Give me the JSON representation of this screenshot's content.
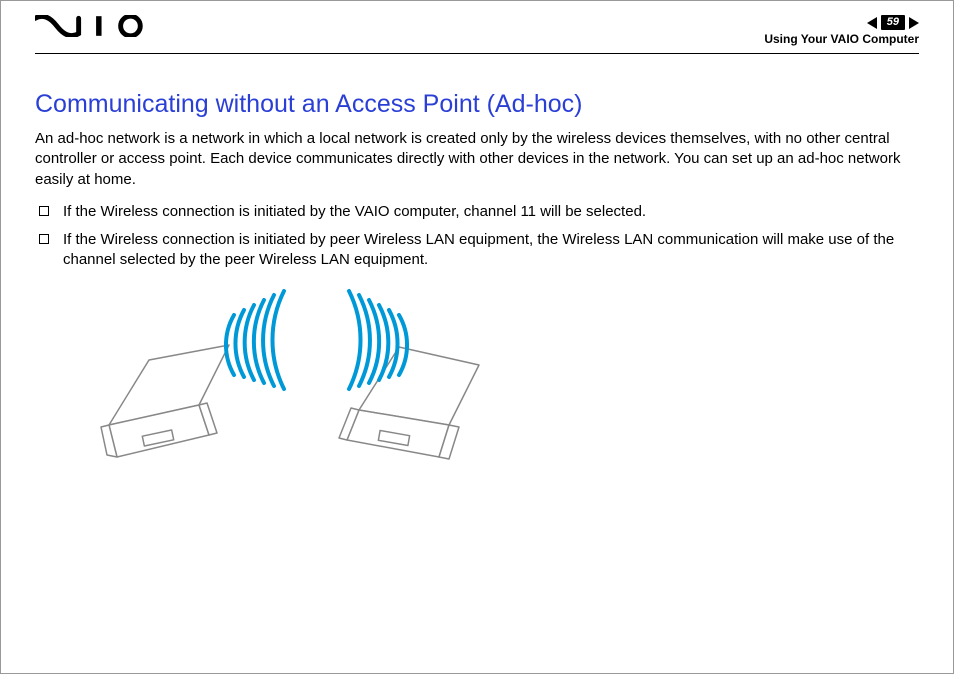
{
  "header": {
    "page_number": "59",
    "breadcrumb": "Using Your VAIO Computer"
  },
  "title": "Communicating without an Access Point (Ad-hoc)",
  "intro": "An ad-hoc network is a network in which a local network is created only by the wireless devices themselves, with no other central controller or access point. Each device communicates directly with other devices in the network. You can set up an ad-hoc network easily at home.",
  "bullets": [
    "If the Wireless connection is initiated by the VAIO computer, channel 11 will be selected.",
    "If the Wireless connection is initiated by peer Wireless LAN equipment, the Wireless LAN communication will make use of the channel selected by the peer Wireless LAN equipment."
  ]
}
